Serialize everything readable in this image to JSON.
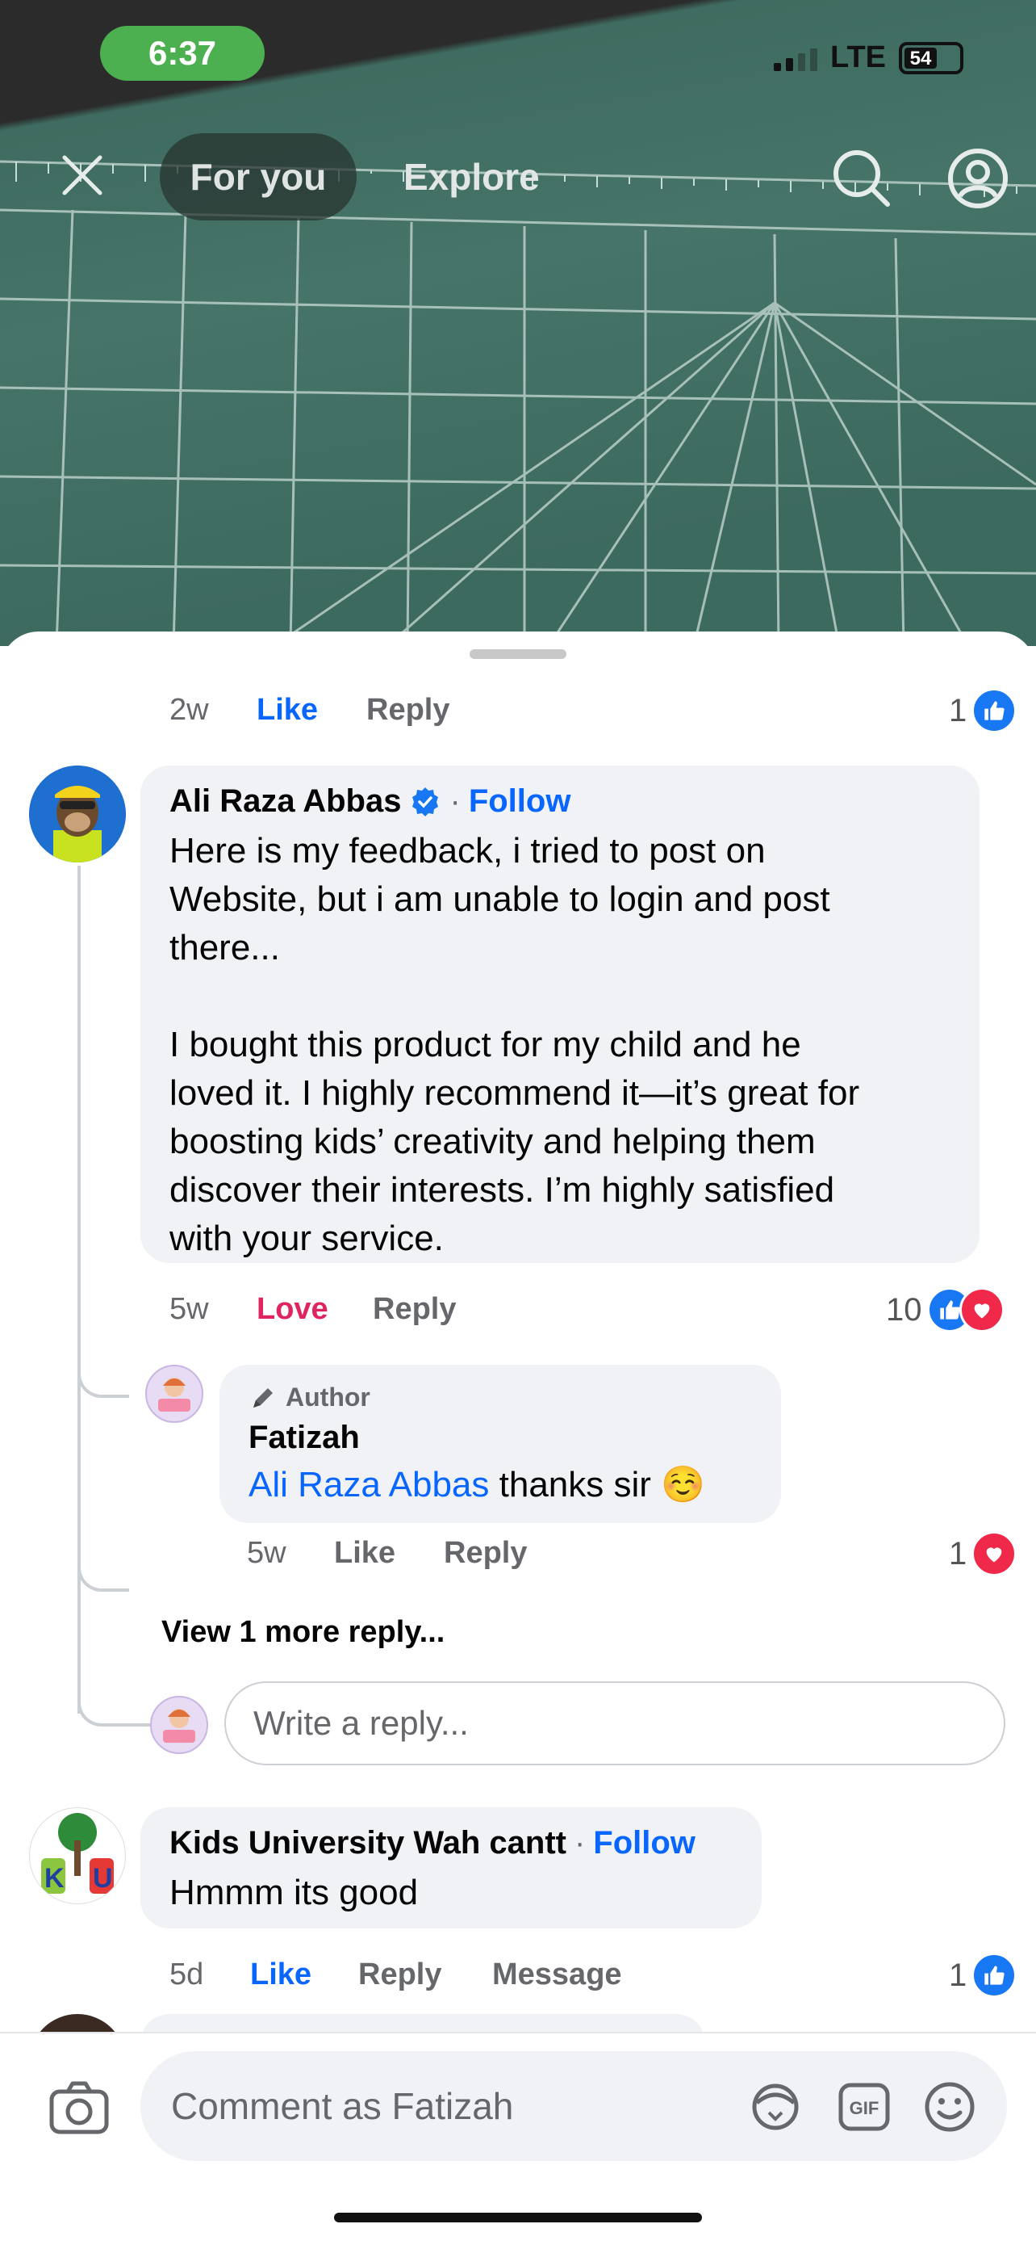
{
  "status_bar": {
    "time": "6:37",
    "network": "LTE",
    "battery": "54"
  },
  "top_nav": {
    "tab_for_you": "For you",
    "tab_explore": "Explore"
  },
  "comments": {
    "prev": {
      "time": "2w",
      "like": "Like",
      "reply": "Reply",
      "count": "1"
    },
    "c1": {
      "author": "Ali Raza Abbas",
      "follow": "Follow",
      "text_lines": [
        "Here is my feedback, i tried to post on",
        "Website, but i am unable to login and post",
        "there...",
        "",
        "I bought this product for my child and he",
        "loved it. I highly recommend it—it’s great for",
        "boosting kids’ creativity and helping them",
        "discover their interests. I’m highly satisfied",
        "with your service."
      ],
      "time": "5w",
      "reaction": "Love",
      "reply": "Reply",
      "count": "10"
    },
    "r1": {
      "badge": "Author",
      "author": "Fatizah",
      "mention": "Ali Raza Abbas",
      "text": "thanks sir ☺️",
      "time": "5w",
      "like": "Like",
      "reply": "Reply",
      "count": "1"
    },
    "view_more": "View 1 more reply...",
    "reply_placeholder": "Write a reply...",
    "c2": {
      "author": "Kids University Wah cantt",
      "follow": "Follow",
      "text": "Hmmm its good",
      "time": "5d",
      "like": "Like",
      "reply": "Reply",
      "message": "Message",
      "count": "1"
    }
  },
  "composer": {
    "placeholder": "Comment as Fatizah"
  },
  "colors": {
    "link_blue": "#0866ff",
    "love_red": "#e0245e",
    "like_blue": "#1877f2",
    "bubble_gray": "#f0f2f5"
  }
}
